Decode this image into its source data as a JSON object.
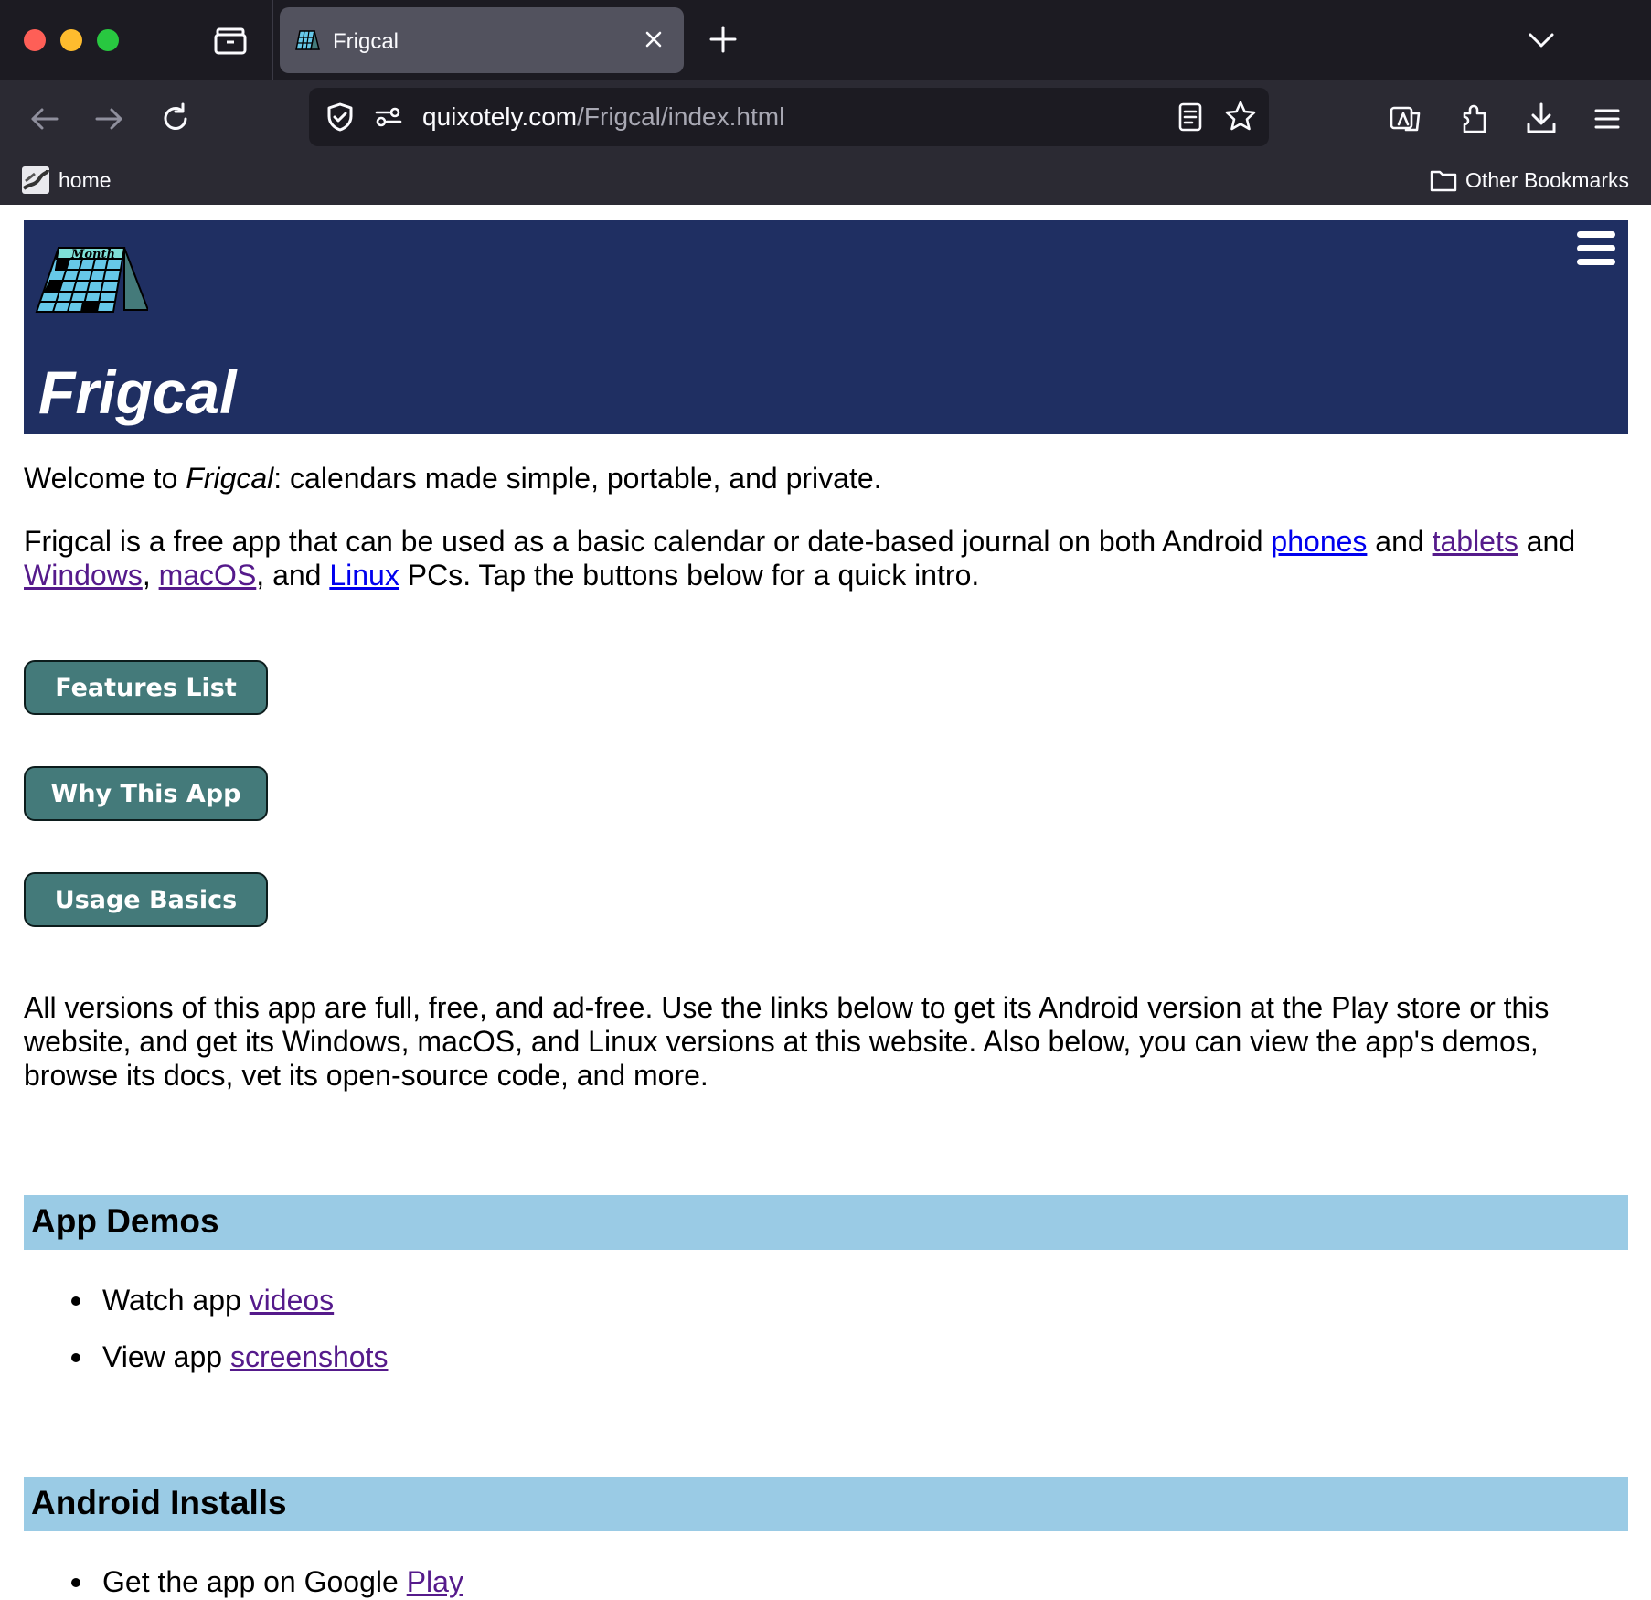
{
  "browser": {
    "tab_title": "Frigcal",
    "url_domain": "quixotely.com",
    "url_path": "/Frigcal/index.html",
    "bookmarks": {
      "home_label": "home",
      "other_label": "Other Bookmarks"
    }
  },
  "header": {
    "logo_text": "Month",
    "site_title": "Frigcal"
  },
  "intro": {
    "welcome_prefix": "Welcome to ",
    "welcome_app": "Frigcal",
    "welcome_suffix": ": calendars made simple, portable, and private.",
    "p2_part1": "Frigcal is a free app that can be used as a basic calendar or date-based journal on both Android ",
    "link_phones": "phones",
    "p2_and1": " and ",
    "link_tablets": "tablets",
    "p2_and2": " and",
    "link_windows": "Windows",
    "p2_comma": ", ",
    "link_macos": "macOS",
    "p2_and3": ", and ",
    "link_linux": "Linux",
    "p2_end": " PCs. Tap the buttons below for a quick intro."
  },
  "buttons": {
    "features": "Features List",
    "why": "Why This App",
    "usage": "Usage Basics"
  },
  "versions_text": "All versions of this app are full, free, and ad-free. Use the links below to get its Android version at the Play store or this website, and get its Windows, macOS, and Linux versions at this website. Also below, you can view the app's demos, browse its docs, vet its open-source code, and more.",
  "sections": {
    "demos": {
      "title": "App Demos",
      "item1_prefix": "Watch app ",
      "item1_link": "videos",
      "item2_prefix": "View app ",
      "item2_link": "screenshots"
    },
    "android": {
      "title": "Android Installs",
      "item1_prefix": "Get the app on Google ",
      "item1_link": "Play"
    }
  },
  "colors": {
    "header_bg": "#1f2f62",
    "button_bg": "#447a7a",
    "section_bg": "#9acbe5",
    "link_unvisited": "#0000ee",
    "link_visited": "#551a8b"
  }
}
